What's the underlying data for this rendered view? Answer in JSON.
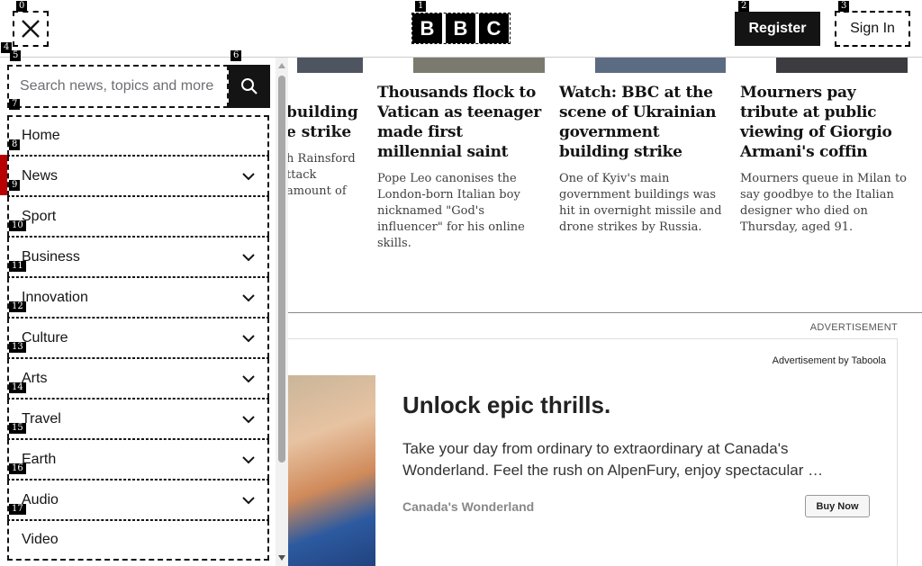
{
  "header": {
    "close_label": "Close menu",
    "logo_letters": [
      "B",
      "B",
      "C"
    ],
    "register_label": "Register",
    "signin_label": "Sign In"
  },
  "articles": {
    "partial_title_lines": [
      "building",
      "e strike"
    ],
    "partial_summary_lines": [
      "h Rainsford",
      "ttack",
      "amount of"
    ],
    "items": [
      {
        "title": "Thousands flock to Vatican as teenager made first millennial saint",
        "summary": "Pope Leo canonises the London-born Italian boy nicknamed \"God's influencer\" for his online skills."
      },
      {
        "title": "Watch: BBC at the scene of Ukrainian government building strike",
        "summary": "One of Kyiv's main government buildings was hit in overnight missile and drone strikes by Russia."
      },
      {
        "title": "Mourners pay tribute at public viewing of Giorgio Armani's coffin",
        "summary": "Mourners queue in Milan to say goodbye to the Italian designer who died on Thursday, aged 91."
      }
    ]
  },
  "ad": {
    "label": "ADVERTISEMENT",
    "by": "Advertisement by Taboola",
    "title": "Unlock epic thrills.",
    "text": "Take your day from ordinary to extraordinary at Canada's Wonderland. Feel the rush on AlpenFury, enjoy spectacular …",
    "brand": "Canada's Wonderland",
    "cta": "Buy Now"
  },
  "menu": {
    "search_placeholder": "Search news, topics and more",
    "items": [
      {
        "label": "Home",
        "has_chevron": false
      },
      {
        "label": "News",
        "has_chevron": true
      },
      {
        "label": "Sport",
        "has_chevron": false
      },
      {
        "label": "Business",
        "has_chevron": true
      },
      {
        "label": "Innovation",
        "has_chevron": true
      },
      {
        "label": "Culture",
        "has_chevron": true
      },
      {
        "label": "Arts",
        "has_chevron": true
      },
      {
        "label": "Travel",
        "has_chevron": true
      },
      {
        "label": "Earth",
        "has_chevron": true
      },
      {
        "label": "Audio",
        "has_chevron": true
      },
      {
        "label": "Video",
        "has_chevron": false
      }
    ]
  },
  "badges": [
    "0",
    "1",
    "2",
    "3",
    "4",
    "5",
    "6",
    "7",
    "8",
    "9",
    "10",
    "11",
    "12",
    "13",
    "14",
    "15",
    "16",
    "17"
  ],
  "colors": {
    "accent": "#b80000",
    "ink": "#141414"
  }
}
